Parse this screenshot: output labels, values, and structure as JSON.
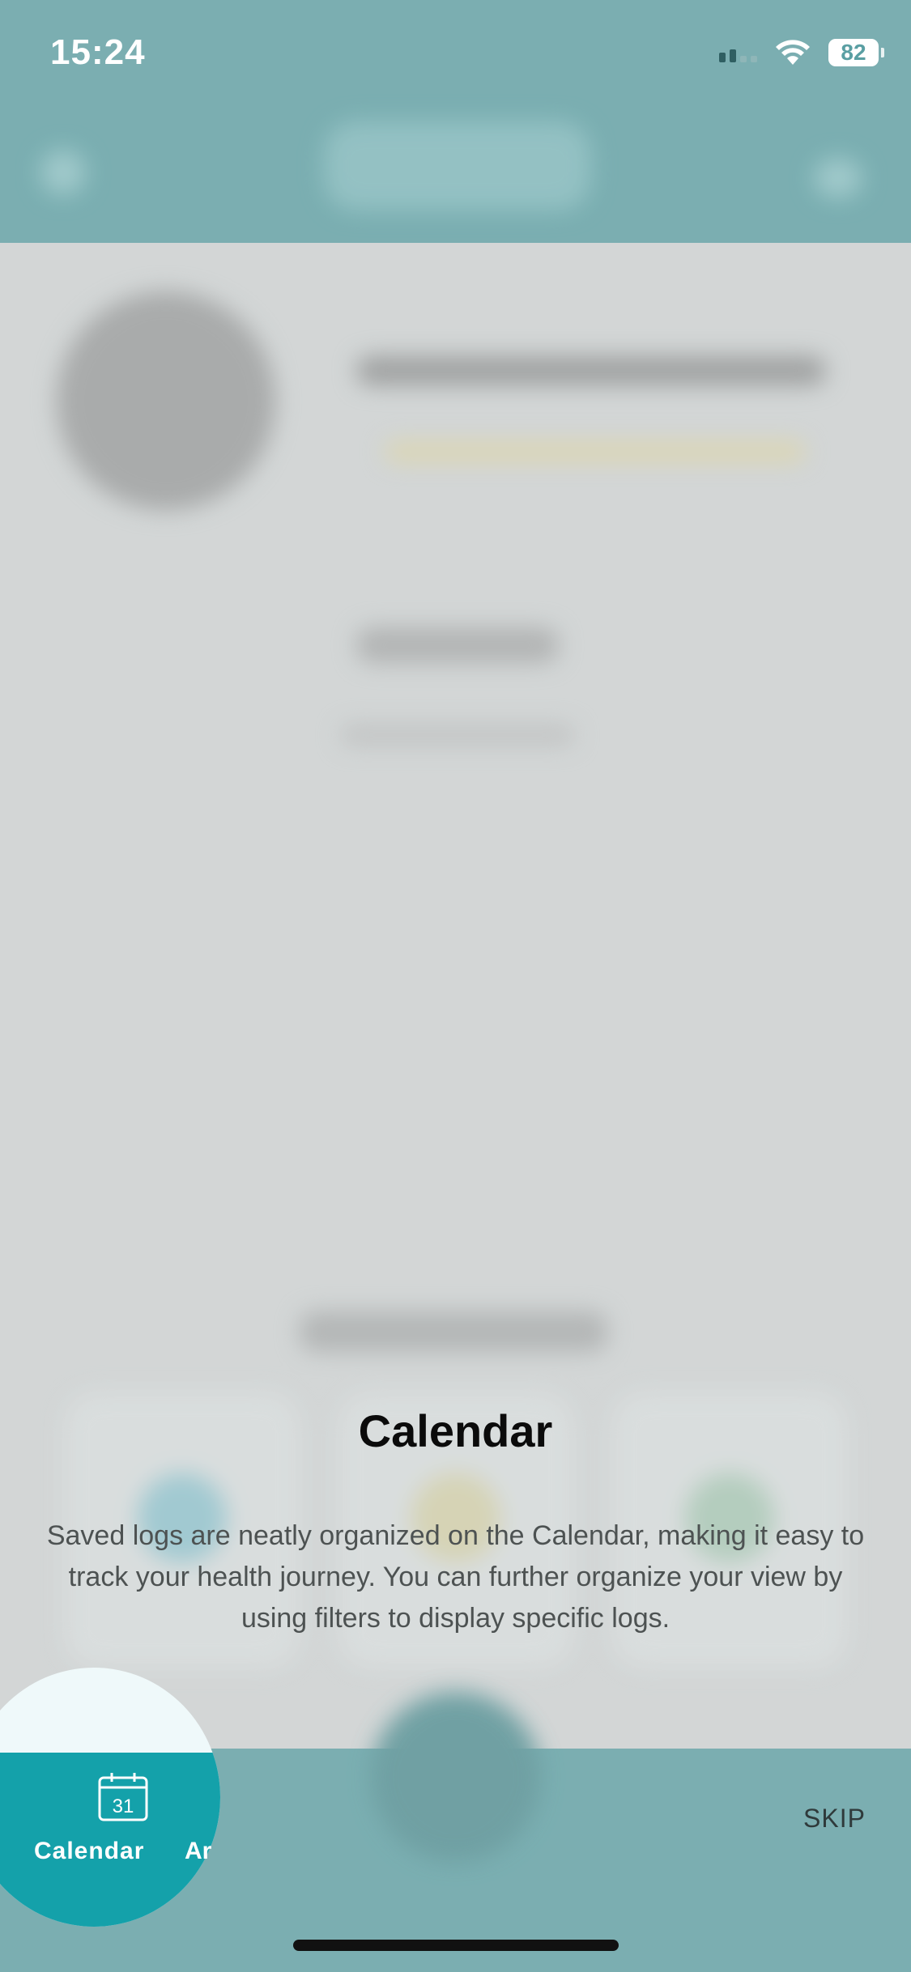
{
  "status_bar": {
    "time": "15:24",
    "battery": "82"
  },
  "coach_mark": {
    "title": "Calendar",
    "description": "Saved logs are neatly organized on the Calendar, making it easy to track your health journey. You can further organize your view by using filters to display specific logs.",
    "highlighted_tab": {
      "label": "Calendar",
      "icon": "calendar-icon",
      "icon_day": "31"
    },
    "next_tab_partial_label": "Ar"
  },
  "actions": {
    "skip_label": "SKIP"
  },
  "colors": {
    "header_teal": "#5a9fa3",
    "tab_active_teal": "#14a1aa",
    "spotlight_top": "#eff9fa"
  }
}
